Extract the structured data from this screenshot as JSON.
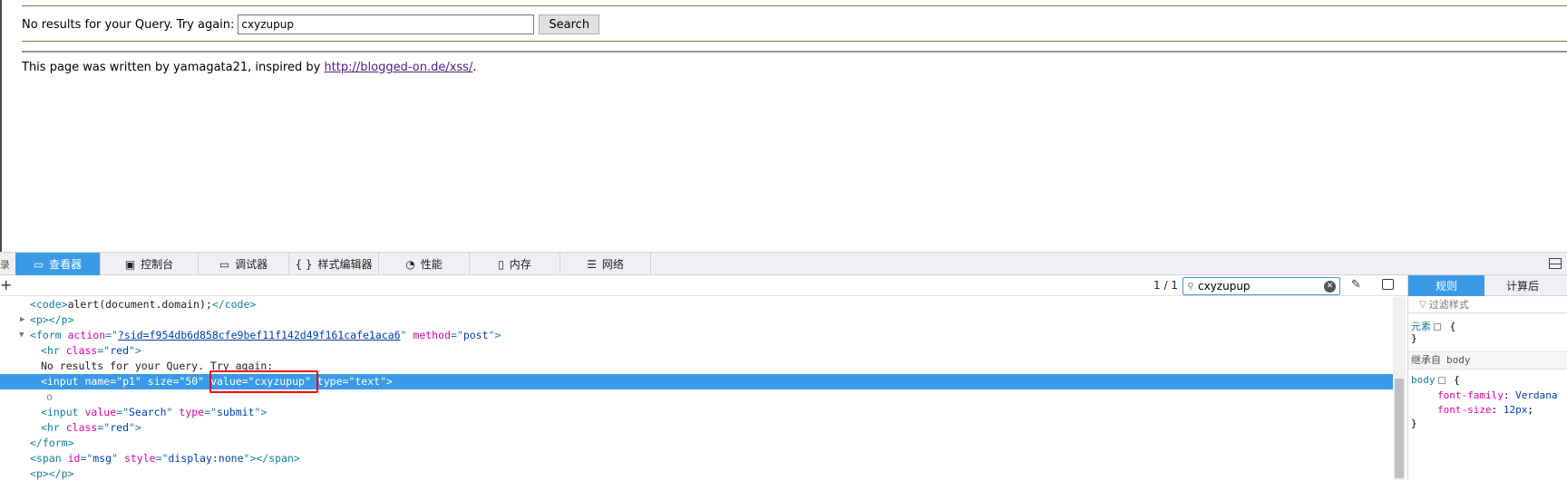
{
  "page": {
    "query_message": "No results for your Query. Try again:",
    "query_value": "cxyzupup",
    "search_label": "Search",
    "footer_prefix": "This page was written by yamagata21, inspired by ",
    "footer_link": "http://blogged-on.de/xss/",
    "footer_suffix": "."
  },
  "devtools": {
    "left_cut_label": "录",
    "tabs": [
      {
        "label": "查看器",
        "icon": "inspector-icon"
      },
      {
        "label": "控制台",
        "icon": "console-icon"
      },
      {
        "label": "调试器",
        "icon": "debugger-icon"
      },
      {
        "label": "样式编辑器",
        "icon": "style-editor-icon"
      },
      {
        "label": "性能",
        "icon": "performance-icon"
      },
      {
        "label": "内存",
        "icon": "memory-icon"
      },
      {
        "label": "网络",
        "icon": "network-icon"
      }
    ],
    "search_value": "cxyzupup",
    "match_count": "1 / 1",
    "markup": {
      "l1_tag": "code",
      "l1_text": "alert(document.domain);",
      "l2_tag": "p",
      "l3_tag": "form",
      "l3_attr1": "action",
      "l3_val1": "?sid=f954db6d858cfe9bef11f142d49f161cafe1aca6",
      "l3_attr2": "method",
      "l3_val2": "post",
      "l4_tag": "hr",
      "l4_attr": "class",
      "l4_val": "red",
      "l5_text": "No results for your Query. Try again:",
      "l6_tag": "input",
      "l6_a1": "name",
      "l6_v1": "p1",
      "l6_a2": "size",
      "l6_v2": "50",
      "l6_a3": "value",
      "l6_v3": "cxyzupup",
      "l6_a4": "type",
      "l6_v4": "text",
      "l7_text": "o",
      "l8_tag": "input",
      "l8_a1": "value",
      "l8_v1": "Search",
      "l8_a2": "type",
      "l8_v2": "submit",
      "l9_tag": "hr",
      "l9_attr": "class",
      "l9_val": "red",
      "l10_tag": "form",
      "l11_tag": "span",
      "l11_a1": "id",
      "l11_v1": "msg",
      "l11_a2": "style",
      "l11_v2": "display:none",
      "l12_tag": "p"
    }
  },
  "sidebar": {
    "tab_rules": "规则",
    "tab_computed": "计算后",
    "filter_placeholder": "过滤样式",
    "element_selector": "元素",
    "inherited_label": "继承自",
    "inherited_source": "body",
    "body_selector": "body",
    "prop1_name": "font-family",
    "prop1_value": "Verdana",
    "prop2_name": "font-size",
    "prop2_value": "12px"
  },
  "colors": {
    "accent": "#3b9ae8",
    "highlight_box": "#ff0000"
  }
}
